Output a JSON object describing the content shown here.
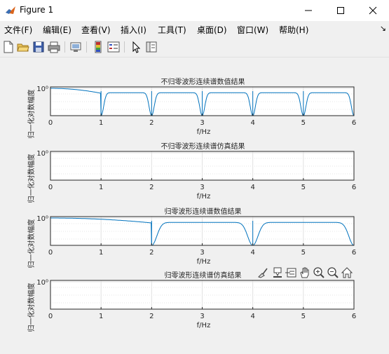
{
  "window": {
    "title": "Figure 1"
  },
  "menu": [
    "文件(F)",
    "编辑(E)",
    "查看(V)",
    "插入(I)",
    "工具(T)",
    "桌面(D)",
    "窗口(W)",
    "帮助(H)"
  ],
  "toolbar_icons": [
    "new-figure-icon",
    "open-file-icon",
    "save-icon",
    "print-icon",
    "link-plot-icon",
    "colorbar-icon",
    "legend-icon",
    "edit-plot-icon",
    "property-inspector-icon"
  ],
  "axes_toolbar_icons": [
    "brush-icon",
    "data-tips-icon",
    "restore-view-icon",
    "pan-icon",
    "zoom-in-icon",
    "zoom-out-icon",
    "home-icon"
  ],
  "chart_data": [
    {
      "type": "line",
      "title": "不归零波形连续谱数值结果",
      "xlabel": "f/Hz",
      "ylabel": "归一化对数幅度",
      "xlim": [
        0,
        6
      ],
      "xticks": [
        "0",
        "1",
        "2",
        "3",
        "4",
        "5",
        "6"
      ],
      "ytick_label": "10⁰",
      "yscale": "log",
      "grid": true,
      "series": [
        {
          "x_nulls": [
            1,
            2,
            3,
            4,
            5,
            6
          ],
          "description_values": [
            1.0
          ]
        }
      ]
    },
    {
      "type": "line",
      "title": "不归零波形连续谱仿真结果",
      "xlabel": "f/Hz",
      "ylabel": "归一化对数幅度",
      "xlim": [
        0,
        6
      ],
      "xticks": [
        "0",
        "1",
        "2",
        "3",
        "4",
        "5",
        "6"
      ],
      "ytick_label": "10⁰",
      "yscale": "log",
      "grid": true,
      "series": []
    },
    {
      "type": "line",
      "title": "归零波形连续谱数值结果",
      "xlabel": "f/Hz",
      "ylabel": "归一化对数幅度",
      "xlim": [
        0,
        6
      ],
      "xticks": [
        "0",
        "1",
        "2",
        "3",
        "4",
        "5",
        "6"
      ],
      "ytick_label": "10⁰",
      "yscale": "log",
      "grid": true,
      "series": [
        {
          "x_nulls": [
            2,
            4,
            6
          ],
          "description_values": [
            1.0
          ]
        }
      ]
    },
    {
      "type": "line",
      "title": "归零波形连续谱仿真结果",
      "xlabel": "f/Hz",
      "ylabel": "归一化对数幅度",
      "xlim": [
        0,
        6
      ],
      "xticks": [
        "0",
        "1",
        "2",
        "3",
        "4",
        "5",
        "6"
      ],
      "ytick_label": "10⁰",
      "yscale": "log",
      "grid": true,
      "series": []
    }
  ]
}
